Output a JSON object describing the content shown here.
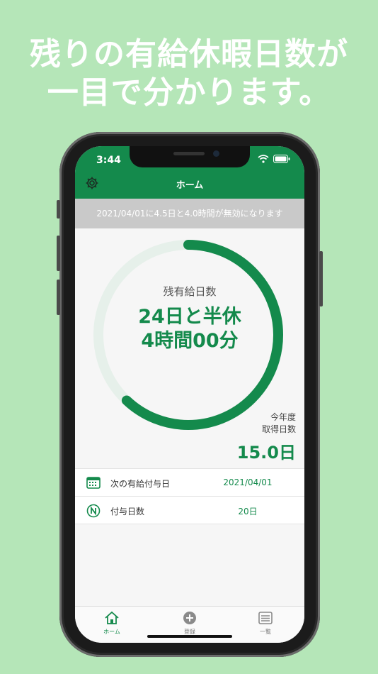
{
  "headline": {
    "line1": "残りの有給休暇日数が",
    "line2": "一目で分かります。"
  },
  "status": {
    "time": "3:44"
  },
  "nav": {
    "title": "ホーム"
  },
  "notice": {
    "text": "2021/04/01に4.5日と4.0時間が無効になります"
  },
  "remaining": {
    "label": "残有給日数",
    "line1": "24日と半休",
    "line2": "4時間00分",
    "progress": 0.62
  },
  "this_year": {
    "label1": "今年度",
    "label2": "取得日数",
    "value": "15.0日"
  },
  "rows": [
    {
      "label": "次の有給付与日",
      "value": "2021/04/01",
      "icon": "calendar-icon"
    },
    {
      "label": "付与日数",
      "value": "20日",
      "icon": "n-circle-icon"
    }
  ],
  "tabs": [
    {
      "label": "ホーム",
      "icon": "home-icon",
      "active": true
    },
    {
      "label": "登録",
      "icon": "plus-circle-icon",
      "active": false
    },
    {
      "label": "一覧",
      "icon": "list-icon",
      "active": false
    }
  ],
  "colors": {
    "accent": "#148a4c",
    "background": "#b5e6b8",
    "ring_track": "#e6f0ea"
  }
}
